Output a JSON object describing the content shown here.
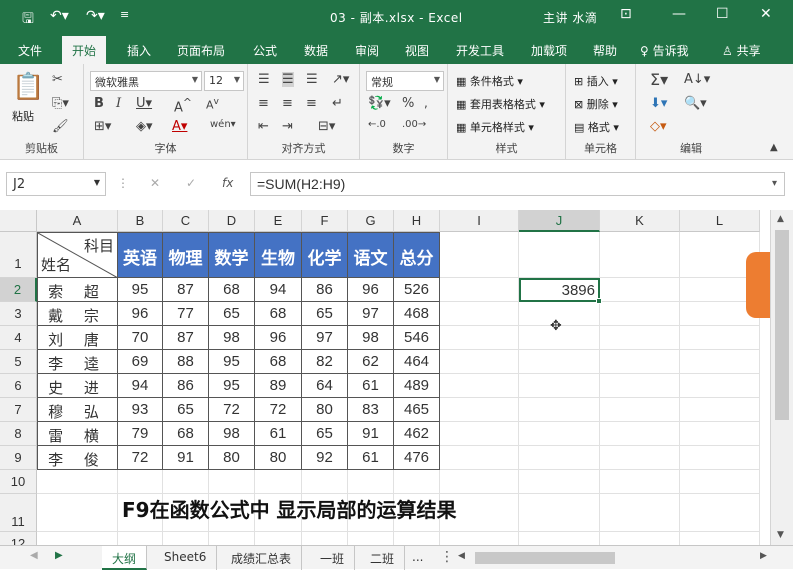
{
  "window": {
    "title": "03 - 副本.xlsx  -  Excel",
    "user": "主讲 水滴"
  },
  "ribbon_tabs": [
    "文件",
    "开始",
    "插入",
    "页面布局",
    "公式",
    "数据",
    "审阅",
    "视图",
    "开发工具",
    "加载项",
    "帮助",
    "告诉我",
    "共享"
  ],
  "clipboard": {
    "paste": "粘贴",
    "label": "剪贴板"
  },
  "font": {
    "name": "微软雅黑",
    "size": "12",
    "label": "字体"
  },
  "alignment": {
    "label": "对齐方式"
  },
  "number": {
    "format": "常规",
    "label": "数字"
  },
  "styles": {
    "cond": "条件格式",
    "table": "套用表格格式",
    "cell": "单元格样式",
    "label": "样式"
  },
  "cells": {
    "insert": "插入",
    "delete": "删除",
    "format": "格式",
    "label": "单元格"
  },
  "editing": {
    "label": "编辑"
  },
  "formula_bar": {
    "namebox": "J2",
    "formula": "=SUM(H2:H9)"
  },
  "columns": [
    "A",
    "B",
    "C",
    "D",
    "E",
    "F",
    "G",
    "H",
    "I",
    "J",
    "K",
    "L"
  ],
  "rows": [
    "1",
    "2",
    "3",
    "4",
    "5",
    "6",
    "7",
    "8",
    "9",
    "10",
    "11",
    "12"
  ],
  "header_diag": {
    "top": "科目",
    "bottom": "姓名"
  },
  "subjects": [
    "英语",
    "物理",
    "数学",
    "生物",
    "化学",
    "语文",
    "总分"
  ],
  "students": [
    {
      "name": "索 超",
      "scores": [
        "95",
        "87",
        "68",
        "94",
        "86",
        "96",
        "526"
      ]
    },
    {
      "name": "戴 宗",
      "scores": [
        "96",
        "77",
        "65",
        "68",
        "65",
        "97",
        "468"
      ]
    },
    {
      "name": "刘 唐",
      "scores": [
        "70",
        "87",
        "98",
        "96",
        "97",
        "98",
        "546"
      ]
    },
    {
      "name": "李 逵",
      "scores": [
        "69",
        "88",
        "95",
        "68",
        "82",
        "62",
        "464"
      ]
    },
    {
      "name": "史 进",
      "scores": [
        "94",
        "86",
        "95",
        "89",
        "64",
        "61",
        "489"
      ]
    },
    {
      "name": "穆 弘",
      "scores": [
        "93",
        "65",
        "72",
        "72",
        "80",
        "83",
        "465"
      ]
    },
    {
      "name": "雷 横",
      "scores": [
        "79",
        "68",
        "98",
        "61",
        "65",
        "91",
        "462"
      ]
    },
    {
      "name": "李 俊",
      "scores": [
        "72",
        "91",
        "80",
        "80",
        "92",
        "61",
        "476"
      ]
    }
  ],
  "j2_value": "3896",
  "caption": "F9在函数公式中 显示局部的运算结果",
  "sheet_tabs": [
    "大纲",
    "Sheet6",
    "成绩汇总表",
    "一班",
    "二班",
    "..."
  ],
  "colors": {
    "excel_green": "#217346",
    "header_blue": "#4472c4"
  }
}
